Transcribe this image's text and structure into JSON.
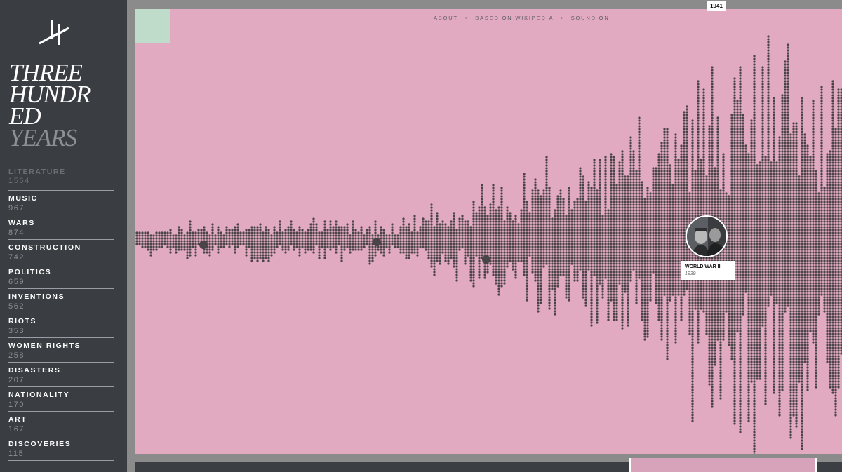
{
  "site": {
    "title_lines": [
      "THREE",
      "HUNDR",
      "ED",
      "YEARS"
    ]
  },
  "nav": {
    "items": [
      "ABOUT",
      "BASED ON WIKIPEDIA",
      "SOUND ON"
    ],
    "separator": "•"
  },
  "categories": [
    {
      "name": "LITERATURE",
      "count": "1564"
    },
    {
      "name": "MUSIC",
      "count": "967"
    },
    {
      "name": "WARS",
      "count": "874"
    },
    {
      "name": "CONSTRUCTION",
      "count": "742"
    },
    {
      "name": "POLITICS",
      "count": "659"
    },
    {
      "name": "INVENTIONS",
      "count": "562"
    },
    {
      "name": "RIOTS",
      "count": "353"
    },
    {
      "name": "WOMEN RIGHTS",
      "count": "258"
    },
    {
      "name": "DISASTERS",
      "count": "207"
    },
    {
      "name": "NATIONALITY",
      "count": "170"
    },
    {
      "name": "ART",
      "count": "167"
    },
    {
      "name": "DISCOVERIES",
      "count": "115"
    }
  ],
  "timeline": {
    "current_year": "1941",
    "selected_event": {
      "title": "WORLD WAR II",
      "year": "1939"
    }
  },
  "colors": {
    "sidebar": "#3a3d42",
    "chart_background": "#e1aac0",
    "dot": "#4a4448",
    "accent_mint": "#bfdccb",
    "timeline_window": "#d7a3bb"
  },
  "icons": {
    "logo": "double-slash-logo",
    "event_avatar": "portrait-photo"
  }
}
